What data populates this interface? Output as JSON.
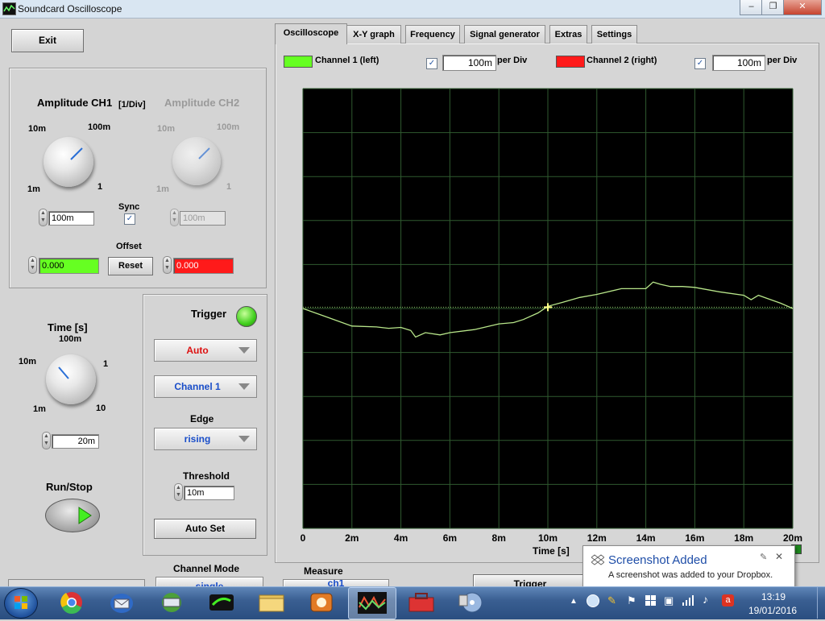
{
  "window": {
    "title": "Soundcard Oscilloscope",
    "min_btn": "–",
    "max_btn": "❐",
    "close_btn": "✕"
  },
  "left": {
    "exit_label": "Exit",
    "amp_ch1": {
      "title": "Amplitude CH1",
      "unit": "[1/Div]",
      "t1": "10m",
      "t2": "100m",
      "t3": "1m",
      "t4": "1",
      "value": "100m"
    },
    "amp_ch2": {
      "title": "Amplitude CH2",
      "t1": "10m",
      "t2": "100m",
      "t3": "1m",
      "t4": "1",
      "value": "100m"
    },
    "sync_label": "Sync",
    "offset_label": "Offset",
    "offset_ch1": "0.000",
    "offset_ch2": "0.000",
    "reset_label": "Reset",
    "time": {
      "title": "Time [s]",
      "t_left": "10m",
      "t_top": "100m",
      "t_right": "1",
      "t_bl": "1m",
      "t_br": "10",
      "value": "20m"
    },
    "runstop_label": "Run/Stop"
  },
  "trigger": {
    "title": "Trigger",
    "mode": "Auto",
    "channel": "Channel 1",
    "edge_label": "Edge",
    "edge": "rising",
    "threshold_label": "Threshold",
    "threshold": "10m",
    "autoset_label": "Auto Set"
  },
  "channel_mode_label": "Channel Mode",
  "channel_mode_value": "single",
  "tabs": [
    "Oscilloscope",
    "X-Y graph",
    "Frequency",
    "Signal generator",
    "Extras",
    "Settings"
  ],
  "legend": {
    "ch1_label": "Channel 1 (left)",
    "ch1_color": "#66ff22",
    "ch1_div": "100m",
    "ch2_label": "Channel 2 (right)",
    "ch2_color": "#ff1a1a",
    "ch2_div": "100m",
    "per_div": "per Div",
    "check": "✓"
  },
  "chart_data": {
    "type": "line",
    "xlabel": "Time [s]",
    "x_tick_labels": [
      "0",
      "2m",
      "4m",
      "6m",
      "8m",
      "10m",
      "12m",
      "14m",
      "16m",
      "18m",
      "20m"
    ],
    "xlim": [
      0,
      20
    ],
    "ylim": [
      -5,
      5
    ],
    "grid": true,
    "background": "#000000",
    "grid_color": "#2f5a2f",
    "series": [
      {
        "name": "Channel 1 (left)",
        "color": "#b8e68a",
        "x": [
          0,
          1,
          2,
          3,
          3.5,
          4,
          4.4,
          4.6,
          5,
          5.6,
          6,
          7,
          8,
          8.6,
          9,
          9.6,
          10,
          10.6,
          11.3,
          12,
          13,
          14,
          14.3,
          14.6,
          15,
          15.5,
          16,
          17,
          18,
          18.3,
          18.6,
          19,
          19.5,
          20
        ],
        "y": [
          0,
          -0.2,
          -0.4,
          -0.42,
          -0.45,
          -0.43,
          -0.5,
          -0.65,
          -0.55,
          -0.6,
          -0.55,
          -0.48,
          -0.35,
          -0.32,
          -0.25,
          -0.1,
          0.05,
          0.14,
          0.25,
          0.32,
          0.45,
          0.45,
          0.6,
          0.55,
          0.5,
          0.5,
          0.48,
          0.38,
          0.3,
          0.2,
          0.3,
          0.22,
          0.12,
          0
        ]
      }
    ],
    "trigger_level": 0.03,
    "trigger_marker_x": 10
  },
  "measure": {
    "label": "Measure",
    "value": "ch1"
  },
  "trigger_bottom_label": "Trigger",
  "notification": {
    "title": "Screenshot Added",
    "body": "A screenshot was added to your Dropbox."
  },
  "taskbar": {
    "time": "13:19",
    "date": "19/01/2016"
  }
}
